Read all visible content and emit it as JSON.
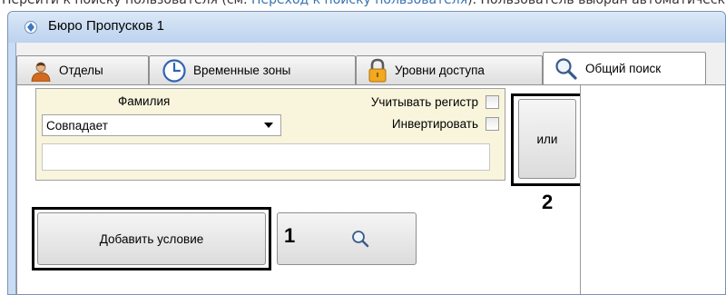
{
  "document": {
    "text_before": "Перейти к поиску пользователя (см. ",
    "link_text": "Переход к поиску пользователя",
    "text_after": "). Пользователь выбран автоматически."
  },
  "window": {
    "title": "Бюро Пропусков 1"
  },
  "tabs": [
    {
      "label": "Отделы",
      "icon": "person-icon",
      "active": false
    },
    {
      "label": "Временные зоны",
      "icon": "clock-icon",
      "active": false
    },
    {
      "label": "Уровни доступа",
      "icon": "padlock-icon",
      "active": false
    },
    {
      "label": "Общий поиск",
      "icon": "magnifier-icon",
      "active": true
    }
  ],
  "filter": {
    "field_label": "Фамилия",
    "match_mode": "Совпадает",
    "case_sensitive_label": "Учитывать регистр",
    "invert_label": "Инвертировать",
    "value": ""
  },
  "buttons": {
    "or_label": "или",
    "add_condition_label": "Добавить условие",
    "search_icon": "magnifier-icon"
  },
  "callouts": {
    "one": "1",
    "two": "2"
  },
  "colors": {
    "panel_background": "#f8f5dc",
    "window_frame": "#c9dcf2",
    "highlight_border": "#000000"
  }
}
